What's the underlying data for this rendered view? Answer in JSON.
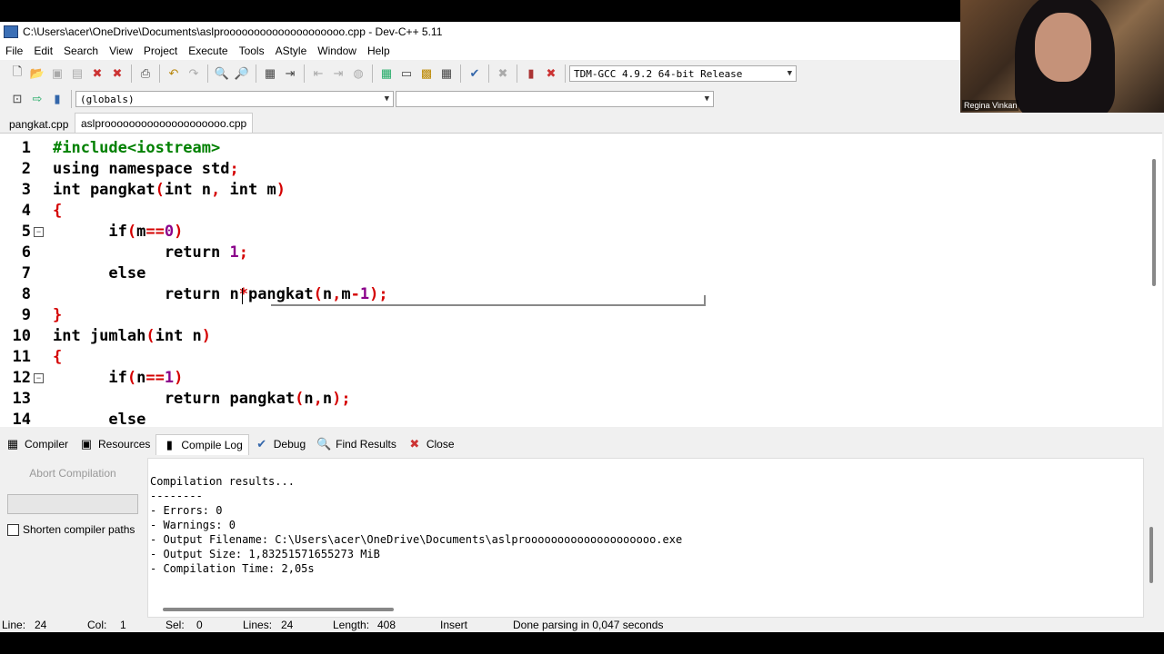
{
  "window": {
    "title": "C:\\Users\\acer\\OneDrive\\Documents\\aslproooooooooooooooooooo.cpp - Dev-C++ 5.11"
  },
  "menu": [
    "File",
    "Edit",
    "Search",
    "View",
    "Project",
    "Execute",
    "Tools",
    "AStyle",
    "Window",
    "Help"
  ],
  "toolbar": {
    "compiler_select": "TDM-GCC 4.9.2 64-bit Release",
    "scope_select": "(globals)",
    "symbol_select": ""
  },
  "tabs": [
    {
      "label": "pangkat.cpp"
    },
    {
      "label": "aslproooooooooooooooooooo.cpp"
    }
  ],
  "editor": {
    "lines": [
      {
        "n": "1"
      },
      {
        "n": "2"
      },
      {
        "n": "3"
      },
      {
        "n": "4"
      },
      {
        "n": "5"
      },
      {
        "n": "6"
      },
      {
        "n": "7"
      },
      {
        "n": "8"
      },
      {
        "n": "9"
      },
      {
        "n": "10"
      },
      {
        "n": "11"
      },
      {
        "n": "12"
      },
      {
        "n": "13"
      },
      {
        "n": "14"
      }
    ]
  },
  "bottom_tabs": [
    {
      "label": "Compiler"
    },
    {
      "label": "Resources"
    },
    {
      "label": "Compile Log"
    },
    {
      "label": "Debug"
    },
    {
      "label": "Find Results"
    },
    {
      "label": "Close"
    }
  ],
  "compile_panel": {
    "abort_label": "Abort Compilation",
    "shorten_label": "Shorten compiler paths",
    "progress": 0,
    "log": [
      "Compilation results...",
      "--------",
      "- Errors: 0",
      "- Warnings: 0",
      "- Output Filename: C:\\Users\\acer\\OneDrive\\Documents\\aslproooooooooooooooooooo.exe",
      "- Output Size: 1,83251571655273 MiB",
      "- Compilation Time: 2,05s"
    ]
  },
  "status": {
    "line_label": "Line:",
    "line_value": "24",
    "col_label": "Col:",
    "col_value": "1",
    "sel_label": "Sel:",
    "sel_value": "0",
    "lines_label": "Lines:",
    "lines_value": "24",
    "length_label": "Length:",
    "length_value": "408",
    "mode": "Insert",
    "message": "Done parsing in 0,047 seconds"
  },
  "webcam": {
    "name": "Regina Vinkan"
  }
}
